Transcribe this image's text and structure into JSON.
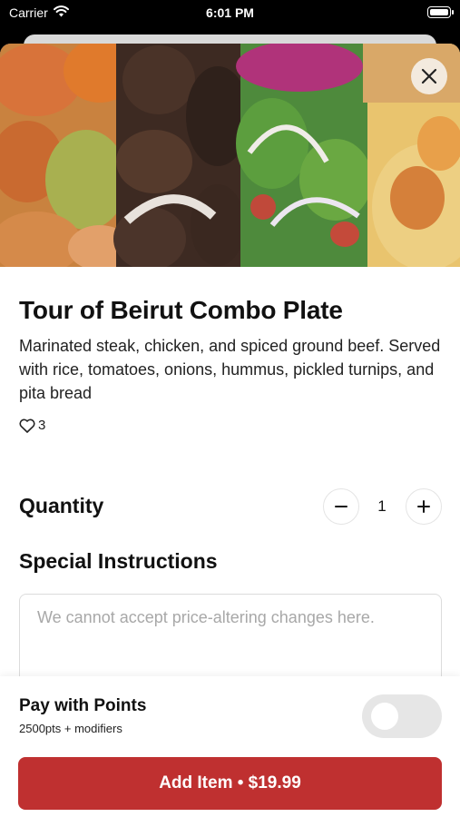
{
  "status_bar": {
    "carrier": "Carrier",
    "time": "6:01 PM"
  },
  "item": {
    "title": "Tour of Beirut Combo Plate",
    "description": "Marinated steak, chicken, and spiced ground beef. Served with rice, tomatoes, onions, hummus, pickled turnips, and pita bread",
    "likes": "3"
  },
  "quantity": {
    "label": "Quantity",
    "value": "1"
  },
  "special_instructions": {
    "label": "Special Instructions",
    "placeholder": "We cannot accept price-altering changes here."
  },
  "footer": {
    "points_title": "Pay with Points",
    "points_subtitle": "2500pts + modifiers",
    "add_button_label": "Add Item • $19.99"
  },
  "colors": {
    "accent": "#bf3030",
    "toggle_off": "#e6e6e6"
  },
  "icons": {
    "close": "close-icon",
    "heart": "heart-icon",
    "minus": "minus-icon",
    "plus": "plus-icon",
    "wifi": "wifi-icon",
    "battery": "battery-icon"
  }
}
